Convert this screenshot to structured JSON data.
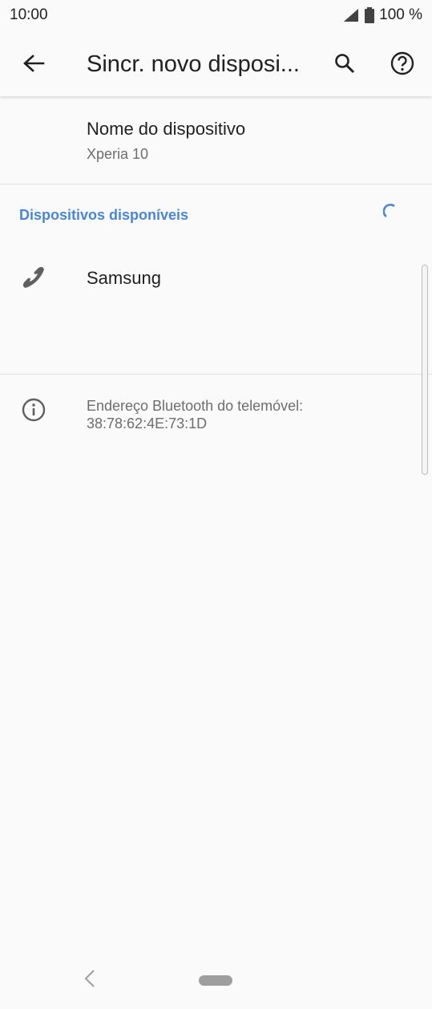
{
  "status": {
    "time": "10:00",
    "battery": "100 %"
  },
  "app_bar": {
    "title": "Sincr. novo disposi...",
    "back_icon": "arrow-back-icon",
    "search_icon": "search-icon",
    "help_icon": "help-circle-icon"
  },
  "device_name": {
    "title": "Nome do dispositivo",
    "value": "Xperia 10"
  },
  "available": {
    "header": "Dispositivos disponíveis",
    "devices": [
      {
        "label": "Samsung",
        "icon": "phone-icon"
      }
    ]
  },
  "info": {
    "icon": "info-icon",
    "line1": "Endereço Bluetooth do telemóvel:",
    "line2": "38:78:62:4E:73:1D"
  },
  "colors": {
    "accent": "#4a86d8",
    "background": "#fafafa"
  }
}
